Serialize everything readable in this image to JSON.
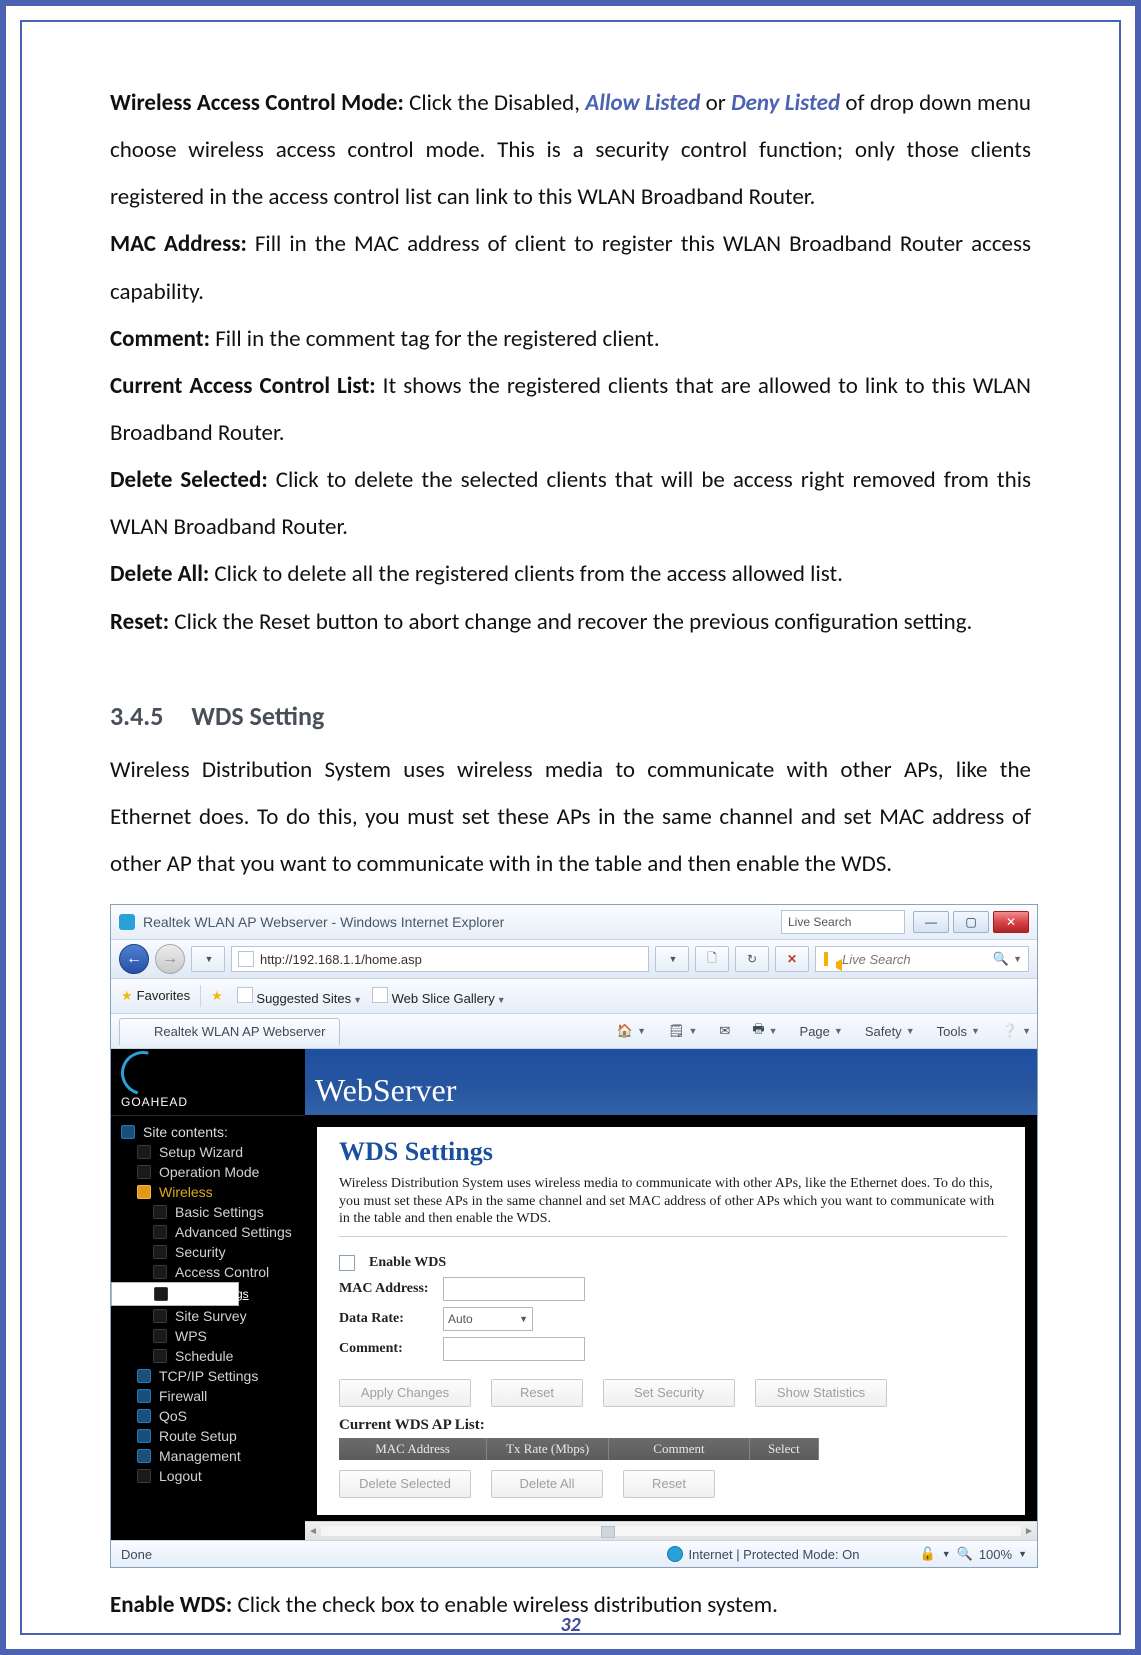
{
  "doc": {
    "p1_strong": "Wireless Access Control Mode:",
    "p1_a": " Click the Disabled, ",
    "p1_allow": "Allow Listed",
    "p1_or": " or ",
    "p1_deny": "Deny Listed",
    "p1_b": " of drop down menu choose wireless access control mode. This is a security control function; only those clients registered in the access control list can link to this WLAN Broadband Router.",
    "p2_strong": "MAC Address:",
    "p2": " Fill in the MAC address of client to register this WLAN Broadband Router access capability.",
    "p3_strong": "Comment:",
    "p3": " Fill in the comment tag for the registered client.",
    "p4_strong": "Current Access Control List:",
    "p4": " It shows the registered clients that are allowed to link to this WLAN Broadband Router.",
    "p5_strong": "Delete Selected:",
    "p5": " Click to delete the selected clients that will be access right removed from this WLAN Broadband Router.",
    "p6_strong": "Delete All:",
    "p6": " Click to delete all the registered clients from the access allowed list.",
    "p7_strong": "Reset:",
    "p7": " Click the Reset button to abort change and recover the previous configuration setting.",
    "section_num": "3.4.5",
    "section_title": "WDS Setting",
    "section_body": "Wireless Distribution System uses wireless media to communicate with other APs, like the Ethernet does. To do this, you must set these APs in the same channel and set MAC address of other AP that you want to communicate with in the table and then enable the WDS.",
    "enable_strong": "Enable WDS:",
    "enable_txt": " Click the check box to enable wireless distribution system.",
    "page_number": "32"
  },
  "ie": {
    "title": "Realtek WLAN AP Webserver - Windows Internet Explorer",
    "live_search": "Live Search",
    "url": "http://192.168.1.1/home.asp",
    "search_placeholder": "Live Search",
    "fav_label": "Favorites",
    "fav_suggested": "Suggested Sites",
    "fav_gallery": "Web Slice Gallery",
    "tab": "Realtek WLAN AP Webserver",
    "cmd_page": "Page",
    "cmd_safety": "Safety",
    "cmd_tools": "Tools",
    "status_done": "Done",
    "status_mode": "Internet | Protected Mode: On",
    "zoom": "100%"
  },
  "router": {
    "banner": "WebServer",
    "brand": "GOAHEAD",
    "sidebar": {
      "root": "Site contents:",
      "items": [
        "Setup Wizard",
        "Operation Mode",
        "Wireless",
        "Basic Settings",
        "Advanced Settings",
        "Security",
        "Access Control",
        "WDS settings",
        "Site Survey",
        "WPS",
        "Schedule",
        "TCP/IP Settings",
        "Firewall",
        "QoS",
        "Route Setup",
        "Management",
        "Logout"
      ]
    },
    "panel": {
      "heading": "WDS Settings",
      "intro": "Wireless Distribution System uses wireless media to communicate with other APs, like the Ethernet does. To do this, you must set these APs in the same channel and set MAC address of other APs which you want to communicate with in the table and then enable the WDS.",
      "enable": "Enable WDS",
      "mac": "MAC Address:",
      "rate": "Data Rate:",
      "rate_val": "Auto",
      "comment": "Comment:",
      "btn_apply": "Apply Changes",
      "btn_reset": "Reset",
      "btn_sec": "Set Security",
      "btn_stats": "Show Statistics",
      "list_h": "Current WDS AP List:",
      "cols": [
        "MAC Address",
        "Tx Rate (Mbps)",
        "Comment",
        "Select"
      ],
      "btn_delsel": "Delete Selected",
      "btn_delall": "Delete All",
      "btn_reset2": "Reset"
    }
  }
}
